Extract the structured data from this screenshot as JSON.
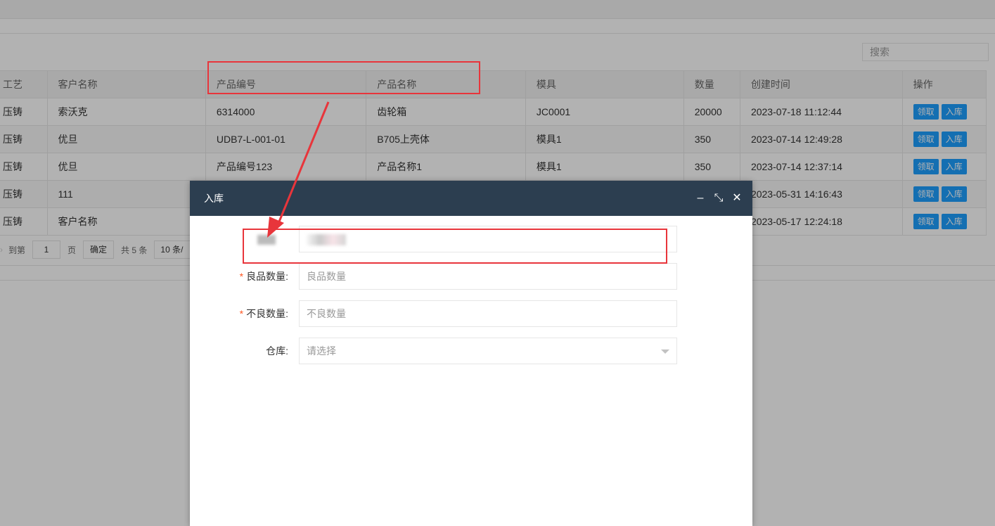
{
  "search": {
    "placeholder": "搜索"
  },
  "table": {
    "columns": [
      "工艺",
      "客户名称",
      "产品编号",
      "产品名称",
      "模具",
      "数量",
      "创建时间",
      "操作"
    ],
    "rows": [
      {
        "process": "压铸",
        "customer": "索沃克",
        "product_no": "6314000",
        "product_name": "齿轮箱",
        "mold": "JC0001",
        "qty": "20000",
        "created": "2023-07-18 11:12:44"
      },
      {
        "process": "压铸",
        "customer": "优旦",
        "product_no": "UDB7-L-001-01",
        "product_name": "B705上壳体",
        "mold": "模具1",
        "qty": "350",
        "created": "2023-07-14 12:49:28"
      },
      {
        "process": "压铸",
        "customer": "优旦",
        "product_no": "产品编号123",
        "product_name": "产品名称1",
        "mold": "模具1",
        "qty": "350",
        "created": "2023-07-14 12:37:14"
      },
      {
        "process": "压铸",
        "customer": "111",
        "product_no": "",
        "product_name": "",
        "mold": "",
        "qty": "",
        "created": "2023-05-31 14:16:43"
      },
      {
        "process": "压铸",
        "customer": "客户名称",
        "product_no": "",
        "product_name": "",
        "mold": "",
        "qty": "",
        "created": "2023-05-17 12:24:18"
      }
    ],
    "actions": {
      "take": "领取",
      "stock_in": "入库"
    }
  },
  "pager": {
    "goto_label": "到第",
    "page_value": "1",
    "page_unit": "页",
    "confirm": "确定",
    "total": "共 5 条",
    "page_size": "10 条/"
  },
  "dialog": {
    "title": "入库",
    "controls": {
      "minimize": "–",
      "restore": "⤡",
      "close": "✕"
    },
    "fields": {
      "good_qty": {
        "label": "良品数量",
        "placeholder": "良品数量"
      },
      "bad_qty": {
        "label": "不良数量",
        "placeholder": "不良数量"
      },
      "warehouse": {
        "label": "仓库",
        "placeholder": "请选择"
      }
    }
  },
  "colors": {
    "accent": "#1E9FFF",
    "dialog_header": "#2c3e50",
    "annotation": "#e8353b",
    "required": "#ff5722"
  }
}
